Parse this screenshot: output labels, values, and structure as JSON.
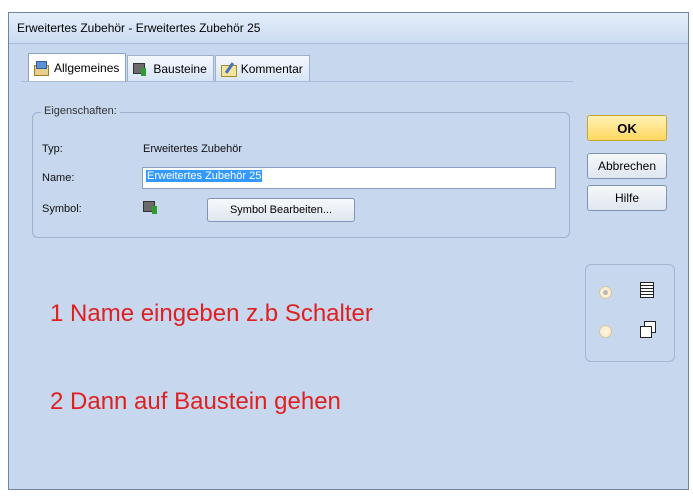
{
  "window": {
    "title": "Erweitertes Zubehör - Erweitertes Zubehör 25"
  },
  "tabs": [
    {
      "label": "Allgemeines",
      "icon": "general-properties-icon",
      "active": true
    },
    {
      "label": "Bausteine",
      "icon": "blocks-icon",
      "active": false
    },
    {
      "label": "Kommentar",
      "icon": "comment-icon",
      "active": false
    }
  ],
  "properties": {
    "group_title": "Eigenschaften:",
    "type_label": "Typ:",
    "type_value": "Erweitertes Zubehör",
    "name_label": "Name:",
    "name_value": "Erweitertes Zubehör 25",
    "symbol_label": "Symbol:",
    "symbol_icon": "accessory-symbol-icon",
    "symbol_button": "Symbol Bearbeiten..."
  },
  "buttons": {
    "ok": "OK",
    "cancel": "Abbrechen",
    "help": "Hilfe"
  },
  "view_options": [
    {
      "icon": "list-view-icon",
      "checked": true
    },
    {
      "icon": "pages-view-icon",
      "checked": false
    }
  ],
  "annotations": {
    "step1": "1 Name eingeben z.b Schalter",
    "step2": "2 Dann auf Baustein gehen"
  },
  "colors": {
    "annotation": "#e02020",
    "ok_button": "#ffd860",
    "window_bg": "#c6d7ee"
  }
}
